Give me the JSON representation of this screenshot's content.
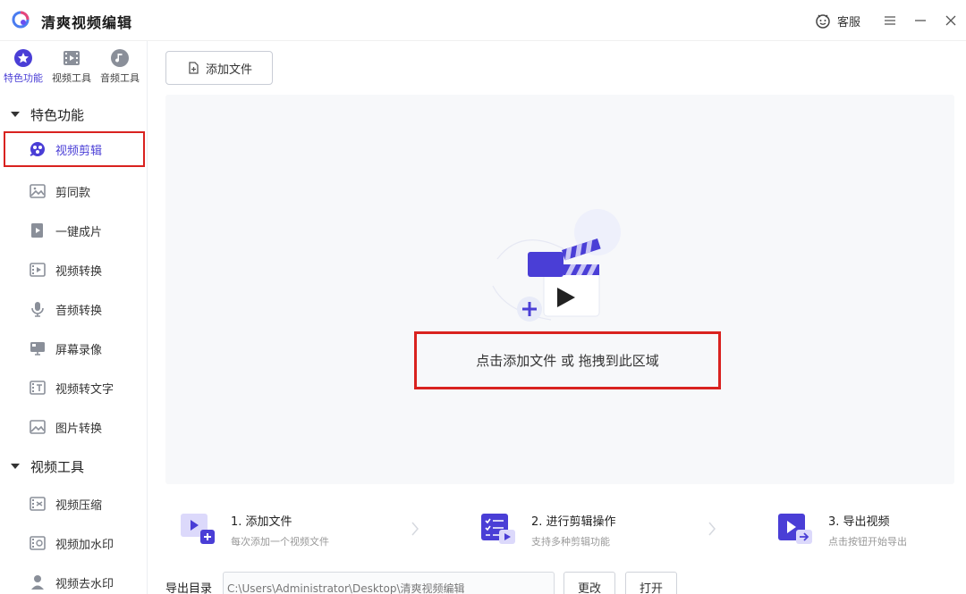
{
  "app": {
    "title": "清爽视频编辑"
  },
  "titlebar": {
    "customer_service": "客服"
  },
  "top_tabs": [
    {
      "label": "特色功能",
      "icon": "star-icon",
      "active": true
    },
    {
      "label": "视频工具",
      "icon": "film-icon"
    },
    {
      "label": "音频工具",
      "icon": "music-icon"
    }
  ],
  "sections": [
    {
      "title": "特色功能",
      "items": [
        {
          "label": "视频剪辑",
          "icon": "video-edit-icon",
          "active": true
        },
        {
          "label": "剪同款",
          "icon": "image-icon"
        },
        {
          "label": "一键成片",
          "icon": "play-file-icon"
        },
        {
          "label": "视频转换",
          "icon": "video-convert-icon"
        },
        {
          "label": "音频转换",
          "icon": "microphone-icon"
        },
        {
          "label": "屏幕录像",
          "icon": "screen-record-icon"
        },
        {
          "label": "视频转文字",
          "icon": "video-text-icon"
        },
        {
          "label": "图片转换",
          "icon": "image-convert-icon"
        }
      ]
    },
    {
      "title": "视频工具",
      "items": [
        {
          "label": "视频压缩",
          "icon": "video-compress-icon"
        },
        {
          "label": "视频加水印",
          "icon": "video-watermark-icon"
        },
        {
          "label": "视频去水印",
          "icon": "remove-watermark-icon"
        }
      ]
    }
  ],
  "main": {
    "add_file_label": "添加文件",
    "dropzone_text": "点击添加文件 或 拖拽到此区域"
  },
  "steps": [
    {
      "title": "1. 添加文件",
      "desc": "每次添加一个视频文件"
    },
    {
      "title": "2. 进行剪辑操作",
      "desc": "支持多种剪辑功能"
    },
    {
      "title": "3. 导出视频",
      "desc": "点击按钮开始导出"
    }
  ],
  "export": {
    "label": "导出目录",
    "path": "C:\\Users\\Administrator\\Desktop\\清爽视频编辑",
    "change_label": "更改",
    "open_label": "打开"
  },
  "colors": {
    "accent": "#4a3ed6",
    "highlight": "#d9221f"
  }
}
